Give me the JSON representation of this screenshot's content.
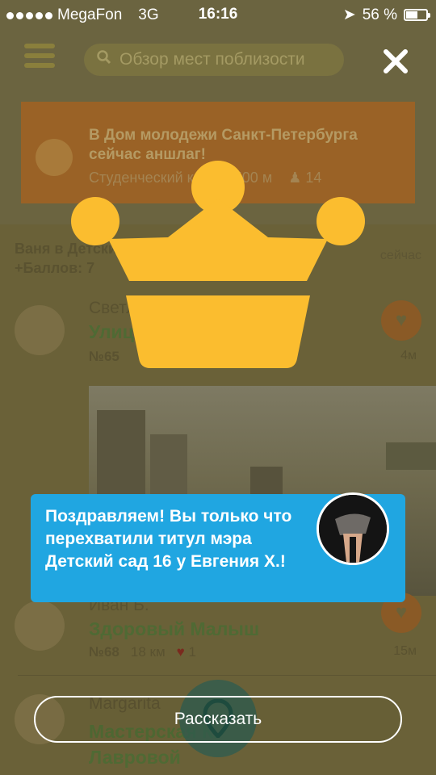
{
  "status_bar": {
    "carrier": "MegaFon",
    "network": "3G",
    "time": "16:16",
    "battery": "56 %"
  },
  "top_bar": {
    "search_placeholder": "Обзор мест поблизости"
  },
  "banner": {
    "title": "В Дом молодежи Санкт-Петербурга сейчас аншлаг!",
    "category": "Студенческий клуб",
    "distance": "500 м",
    "people": "14"
  },
  "feed": {
    "header_line1": "Ваня в Детский сад",
    "header_line2": "+Баллов: 7",
    "header_time": "сейчас",
    "items": [
      {
        "user": "Светлана",
        "place": "Улица",
        "number": "№65",
        "distance": "4м"
      },
      {
        "user": "Иван Б.",
        "place": "Здоровый Малыш",
        "number": "№68",
        "km": "18 км",
        "likes": "1",
        "distance": "15м"
      },
      {
        "user": "Margarita",
        "place": "Мастерская К. Лавровой"
      }
    ]
  },
  "overlay": {
    "toast_text": "Поздравляем! Вы только что перехватили титул мэра Детский сад 16 у Евгения Х.!",
    "share_label": "Рассказать",
    "crown_color": "#fbbd2f",
    "toast_color": "#20a6e1"
  }
}
